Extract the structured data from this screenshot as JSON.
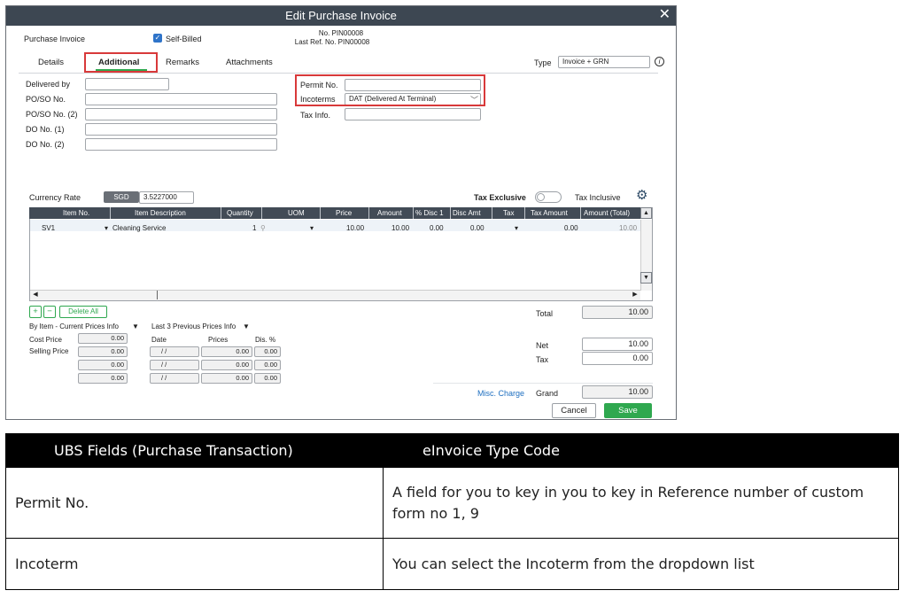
{
  "window": {
    "title": "Edit Purchase Invoice",
    "doc_type": "Purchase Invoice",
    "self_billed_label": "Self-Billed",
    "doc_no": "No. PIN00008",
    "last_ref": "Last Ref. No. PIN00008"
  },
  "tabs": [
    "Details",
    "Additional",
    "Remarks",
    "Attachments"
  ],
  "type_field": {
    "label": "Type",
    "value": "Invoice + GRN"
  },
  "left_fields": [
    "Delivered by",
    "PO/SO No.",
    "PO/SO No. (2)",
    "DO No. (1)",
    "DO No. (2)"
  ],
  "right_fields": {
    "permit_label": "Permit No.",
    "incoterms_label": "Incoterms",
    "incoterms_value": "DAT (Delivered At Terminal)",
    "taxinfo_label": "Tax Info."
  },
  "currency": {
    "label": "Currency Rate",
    "code": "SGD",
    "rate": "3.5227000"
  },
  "tax_toggle": {
    "exclusive": "Tax Exclusive",
    "inclusive": "Tax Inclusive"
  },
  "grid": {
    "columns": [
      "Item No.",
      "Item Description",
      "Quantity",
      "UOM",
      "Price",
      "Amount",
      "% Disc 1",
      "Disc Amt",
      "Tax",
      "Tax Amount",
      "Amount (Total)"
    ],
    "row": {
      "item": "SV1",
      "desc": "Cleaning Service",
      "qty": "1",
      "price": "10.00",
      "amount": "10.00",
      "disc1": "0.00",
      "disc_amt": "0.00",
      "tax_amount": "0.00",
      "total": "10.00"
    }
  },
  "grid_buttons": {
    "add": "+",
    "remove": "−",
    "delete_all": "Delete All"
  },
  "prices": {
    "by_item": "By Item - Current Prices Info",
    "last3": "Last 3 Previous Prices Info",
    "cost_price": "Cost Price",
    "selling_price": "Selling Price",
    "date_header": "Date",
    "prices_header": "Prices",
    "dis_header": "Dis. %",
    "left_values": [
      "0.00",
      "0.00",
      "0.00",
      "0.00"
    ],
    "dates": [
      "/   /",
      "/   /",
      "/   /"
    ],
    "prev_prices": [
      "0.00",
      "0.00",
      "0.00"
    ],
    "prev_dis": [
      "0.00",
      "0.00",
      "0.00"
    ]
  },
  "totals": {
    "total_label": "Total",
    "total": "10.00",
    "net_label": "Net",
    "net": "10.00",
    "tax_label": "Tax",
    "tax": "0.00",
    "misc": "Misc. Charge",
    "grand_label": "Grand",
    "grand": "10.00"
  },
  "actions": {
    "cancel": "Cancel",
    "save": "Save"
  },
  "info_table": {
    "headers": [
      "UBS Fields (Purchase Transaction)",
      "eInvoice Type Code"
    ],
    "rows": [
      [
        "Permit No.",
        "A field for you to key in you to key in Reference number of custom form no 1, 9"
      ],
      [
        "Incoterm",
        "You can select the Incoterm from the dropdown list"
      ]
    ]
  },
  "colors": {
    "titlebar": "#3d4752",
    "save": "#2fa84f",
    "highlight": "#d8393a",
    "link": "#1e6fc0"
  }
}
